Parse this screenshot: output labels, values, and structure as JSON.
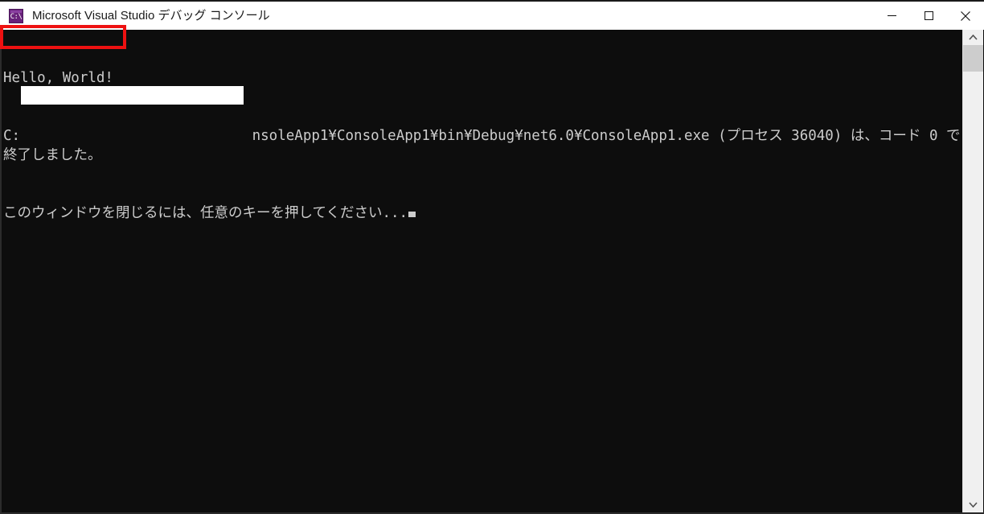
{
  "window": {
    "title": "Microsoft Visual Studio デバッグ コンソール",
    "icon_name": "console-app-icon",
    "icon_glyph": "C:\\",
    "accent_color": "#68217a",
    "titlebar_background": "#ffffff",
    "console_background": "#0d0d0d",
    "console_foreground": "#cccccc"
  },
  "controls": {
    "minimize_label": "最小化",
    "maximize_label": "最大化",
    "close_label": "閉じる"
  },
  "console": {
    "lines": [
      "Hello, World!",
      "C:                                   nsoleApp1¥ConsoleApp1¥bin¥Debug¥net6.0¥ConsoleApp1.exe (プロセス 36040) は、コード 0 で終了しました。",
      "このウィンドウを閉じるには、任意のキーを押してください..."
    ],
    "line1": "Hello, World!",
    "line2_prefix": "C: ",
    "line2_suffix": "nsoleApp1¥ConsoleApp1¥bin¥Debug¥net6.0¥ConsoleApp1.exe (プロセス 36040) は、コード 0 で終了しました。",
    "line3": "このウィンドウを閉じるには、任意のキーを押してください...",
    "cursor_visible": true
  },
  "annotations": {
    "highlight_target": "Hello, World!",
    "highlight_color": "#ee1111",
    "redaction_color": "#ffffff"
  },
  "scrollbar": {
    "up_arrow": "▲",
    "down_arrow": "▼",
    "thumb_position_percent": 3
  }
}
